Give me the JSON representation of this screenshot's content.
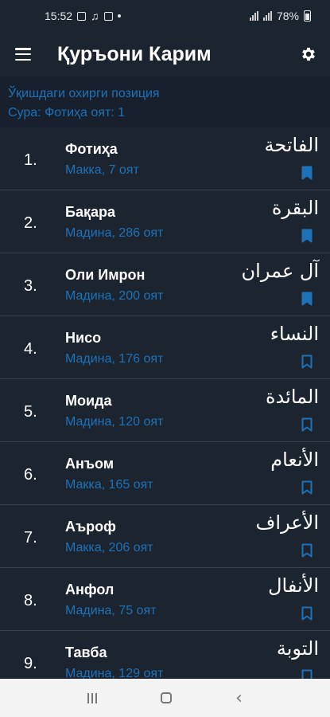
{
  "status": {
    "time": "15:52",
    "battery": "78%"
  },
  "appbar": {
    "title": "Қуръони Карим"
  },
  "last_position": {
    "label": "Ўқишдаги охирги позиция",
    "value": "Сура: Фотиҳа оят: 1"
  },
  "colors": {
    "accent": "#1d72b8",
    "background": "#1c2430",
    "divider": "#3a4350"
  },
  "surahs": [
    {
      "num": "1.",
      "name": "Фотиҳа",
      "info": "Макка, 7 оят",
      "arabic": "الفاتحة",
      "bookmark_filled": true
    },
    {
      "num": "2.",
      "name": "Бақара",
      "info": "Мадина, 286 оят",
      "arabic": "البقرة",
      "bookmark_filled": true
    },
    {
      "num": "3.",
      "name": "Оли Имрон",
      "info": "Мадина, 200 оят",
      "arabic": "آل عمران",
      "bookmark_filled": true
    },
    {
      "num": "4.",
      "name": "Нисо",
      "info": "Мадина, 176 оят",
      "arabic": "النساء",
      "bookmark_filled": false
    },
    {
      "num": "5.",
      "name": "Моида",
      "info": "Мадина, 120 оят",
      "arabic": "المائدة",
      "bookmark_filled": false
    },
    {
      "num": "6.",
      "name": "Анъом",
      "info": "Макка, 165 оят",
      "arabic": "الأنعام",
      "bookmark_filled": false
    },
    {
      "num": "7.",
      "name": "Аъроф",
      "info": "Макка, 206 оят",
      "arabic": "الأعراف",
      "bookmark_filled": false
    },
    {
      "num": "8.",
      "name": "Анфол",
      "info": "Мадина, 75 оят",
      "arabic": "الأنفال",
      "bookmark_filled": false
    },
    {
      "num": "9.",
      "name": "Тавба",
      "info": "Мадина, 129 оят",
      "arabic": "التوبة",
      "bookmark_filled": false
    }
  ]
}
